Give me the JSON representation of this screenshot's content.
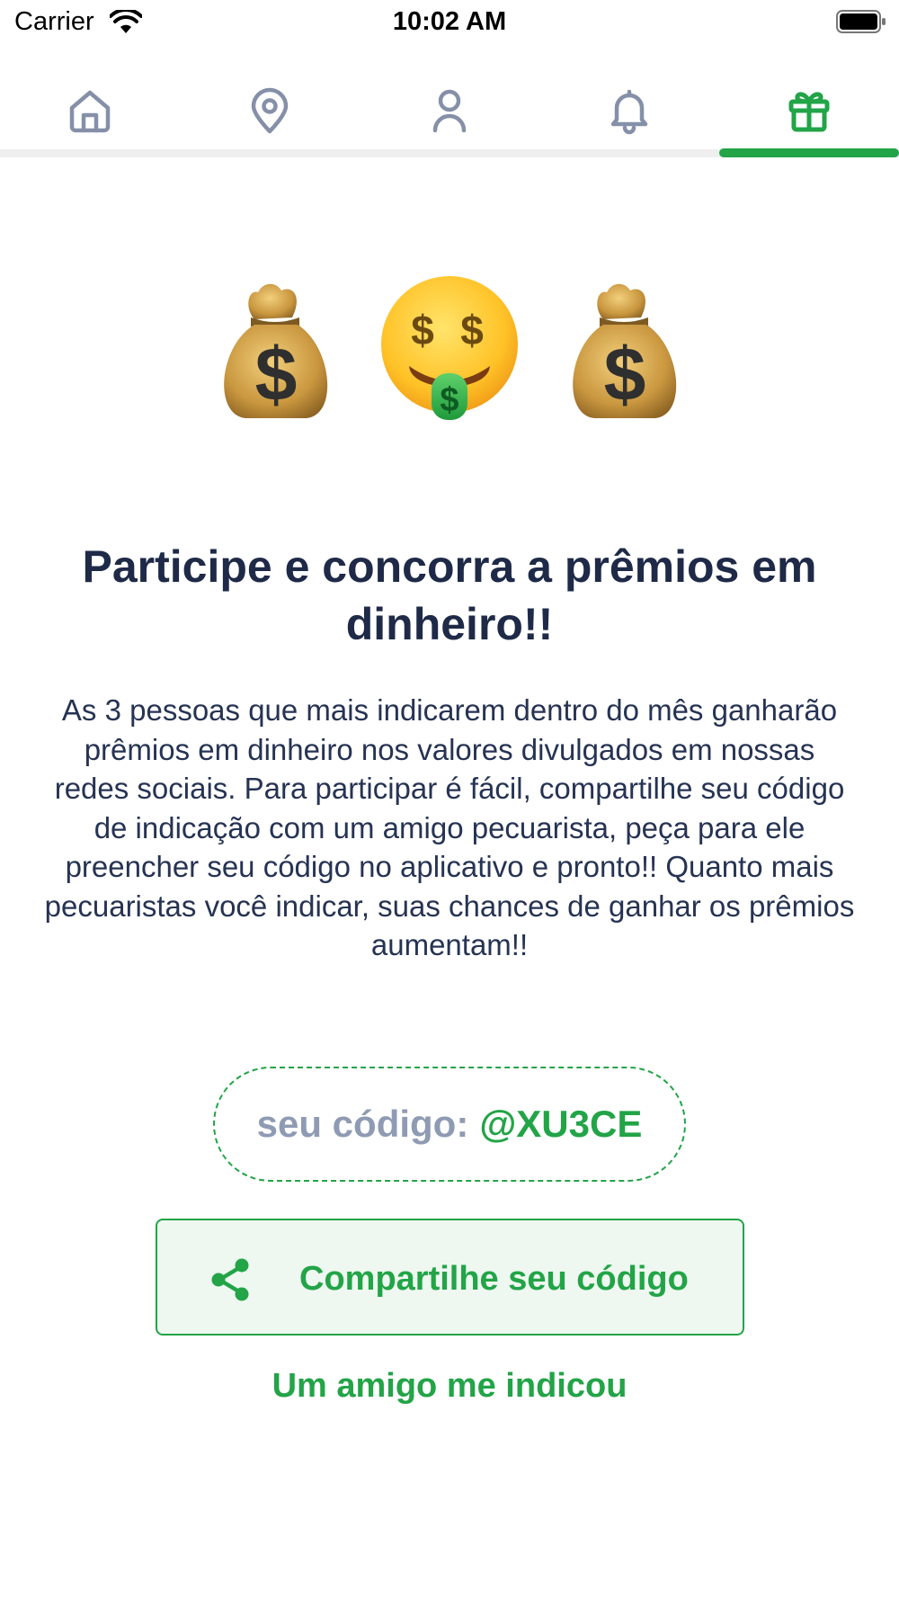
{
  "status_bar": {
    "carrier": "Carrier",
    "time": "10:02 AM",
    "icons": [
      "wifi-icon",
      "battery-icon"
    ]
  },
  "tabs": [
    {
      "icon": "home-icon",
      "active": false
    },
    {
      "icon": "map-pin-icon",
      "active": false
    },
    {
      "icon": "user-icon",
      "active": false
    },
    {
      "icon": "bell-icon",
      "active": false
    },
    {
      "icon": "gift-icon",
      "active": true
    }
  ],
  "hero_emojis": [
    "money-bag-icon",
    "money-mouth-face-icon",
    "money-bag-icon"
  ],
  "content": {
    "title": "Participe e concorra a prêmios em dinheiro!!",
    "description": "As 3 pessoas que mais indicarem dentro do mês ganharão prêmios em dinheiro nos valores divulgados em nossas redes sociais. Para participar é fácil, compartilhe seu código de indicação com um amigo pecuarista, peça para ele preencher seu código no aplicativo e pronto!! Quanto mais pecuaristas você indicar, suas chances de ganhar os prêmios aumentam!!",
    "code_label": "seu código:",
    "code_value": "@XU3CE",
    "share_button": "Compartilhe seu código",
    "friend_link": "Um amigo me indicou"
  },
  "colors": {
    "accent": "#22a447",
    "text_dark": "#1e2a47",
    "muted": "#8f9bb3",
    "icon_gray": "#8590a8",
    "button_bg": "#eef7f0"
  }
}
